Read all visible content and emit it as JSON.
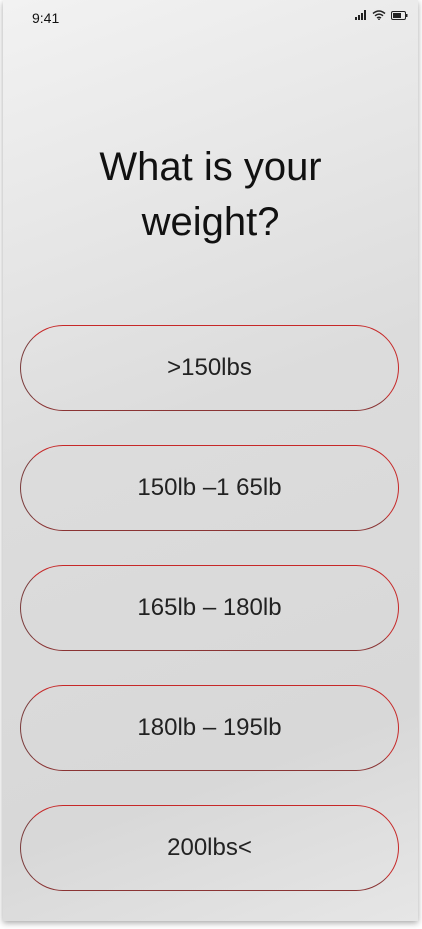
{
  "status_bar": {
    "time": "9:41",
    "icons": [
      "signal-icon",
      "wifi-icon",
      "battery-icon"
    ]
  },
  "question": {
    "line1": "What is your",
    "line2": "weight?"
  },
  "options": [
    {
      "label": ">150lbs"
    },
    {
      "label": "150lb –1 65lb"
    },
    {
      "label": "165lb – 180lb"
    },
    {
      "label": "180lb – 195lb"
    },
    {
      "label": "200lbs<"
    }
  ],
  "colors": {
    "option_border": "#c62828",
    "text": "#111111",
    "background": "#dcdcdc"
  }
}
